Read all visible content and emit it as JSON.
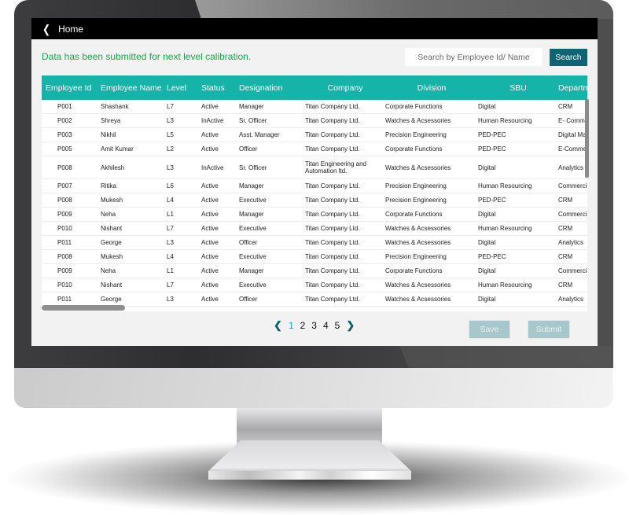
{
  "header": {
    "back_icon": "chevron-left-icon",
    "title": "Home"
  },
  "message": "Data has been submitted for next level calibration.",
  "search": {
    "placeholder": "Search by Employee Id/ Name",
    "button_label": "Search"
  },
  "colors": {
    "header_bg": "#16b3a8",
    "accent": "#0e6470",
    "success": "#1ea64a",
    "disabled_button": "#a7c7cb"
  },
  "table": {
    "columns": [
      "Employee Id",
      "Employee Name",
      "Level",
      "Status",
      "Designation",
      "Company",
      "Division",
      "SBU",
      "Department"
    ],
    "rows": [
      [
        "P001",
        "Shashank",
        "L7",
        "Active",
        "Manager",
        "Titan Company Ltd.",
        "Corporate Functions",
        "Digital",
        "CRM"
      ],
      [
        "P002",
        "Shreya",
        "L3",
        "InActive",
        "Sr. Officer",
        "Titan Company Ltd.",
        "Watches & Acsessories",
        "Human Resourcing",
        "E- Commerce"
      ],
      [
        "P003",
        "Nikhil",
        "L5",
        "Active",
        "Asst. Manager",
        "Titan Company Ltd.",
        "Precision Engineering",
        "PED-PEC",
        "Digital Marketing"
      ],
      [
        "P005",
        "Amit Kumar",
        "L2",
        "Active",
        "Officer",
        "Titan Company Ltd.",
        "Corporate Functions",
        "PED-PEC",
        "E-Commerce"
      ],
      [
        "P008",
        "Akhilesh",
        "L3",
        "InActive",
        "Sr. Officer",
        "Titan Engineering and Automation ltd.",
        "Watches & Acsessories",
        "Digital",
        "Analytics"
      ],
      [
        "P007",
        "Ritika",
        "L6",
        "Active",
        "Manager",
        "Titan Company Ltd.",
        "Precision Engineering",
        "Human Resourcing",
        "Commercial"
      ],
      [
        "P008",
        "Mukesh",
        "L4",
        "Active",
        "Executive",
        "Titan Company Ltd.",
        "Precision Engineering",
        "PED-PEC",
        "CRM"
      ],
      [
        "P009",
        "Neha",
        "L1",
        "Active",
        "Manager",
        "Titan Company Ltd.",
        "Corporate Functions",
        "Digital",
        "Commercial"
      ],
      [
        "P010",
        "Nishant",
        "L7",
        "Active",
        "Executive",
        "Titan Company Ltd.",
        "Watches & Acsessories",
        "Human Resourcing",
        "CRM"
      ],
      [
        "P011",
        "George",
        "L3",
        "Active",
        "Officer",
        "Titan Company Ltd.",
        "Watches & Acsessories",
        "Digital",
        "Analytics"
      ],
      [
        "P008",
        "Mukesh",
        "L4",
        "Active",
        "Executive",
        "Titan Company Ltd.",
        "Precision Engineering",
        "PED-PEC",
        "CRM"
      ],
      [
        "P009",
        "Neha",
        "L1",
        "Active",
        "Manager",
        "Titan Company Ltd.",
        "Corporate Functions",
        "Digital",
        "Commercial"
      ],
      [
        "P010",
        "Nishant",
        "L7",
        "Active",
        "Executive",
        "Titan Company Ltd.",
        "Watches & Acsessories",
        "Human Resourcing",
        "CRM"
      ],
      [
        "P011",
        "George",
        "L3",
        "Active",
        "Officer",
        "Titan Company Ltd.",
        "Watches & Acsessories",
        "Digital",
        "Analytics"
      ]
    ]
  },
  "pagination": {
    "prev_icon": "chevron-left-icon",
    "pages": [
      "1",
      "2",
      "3",
      "4",
      "5"
    ],
    "current_page": "1",
    "next_icon": "chevron-right-icon"
  },
  "actions": {
    "save_label": "Save",
    "submit_label": "Submit"
  }
}
